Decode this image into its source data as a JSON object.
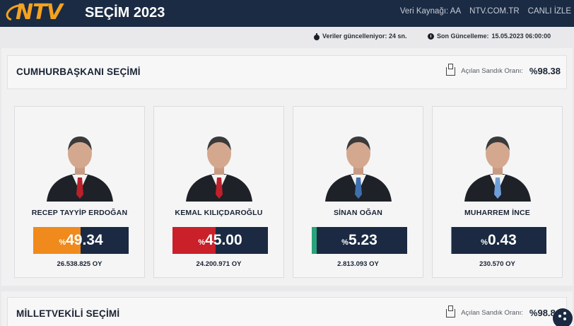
{
  "header": {
    "logo_text": "NTV",
    "app_title": "SEÇİM 2023",
    "links": [
      "Veri Kaynağı: AA",
      "NTV.COM.TR",
      "CANLI İZLE"
    ]
  },
  "status": {
    "refresh_text": "Veriler güncelleniyor: 24 sn.",
    "last_update_label": "Son Güncelleme:",
    "last_update_value": "15.05.2023 06:00:00"
  },
  "presidential": {
    "title": "CUMHURBAŞKANI SEÇİMİ",
    "rate_label": "Açılan Sandık Oranı:",
    "rate_value": "%98.38",
    "candidates": [
      {
        "name": "RECEP TAYYİP ERDOĞAN",
        "percent_sign": "%",
        "percent": "49.34",
        "share": 0.4934,
        "votes": "26.538.825 OY",
        "color": "#f08a1c",
        "tie_color": "#b8202a"
      },
      {
        "name": "KEMAL KILIÇDAROĞLU",
        "percent_sign": "%",
        "percent": "45.00",
        "share": 0.45,
        "votes": "24.200.971 OY",
        "color": "#c9202a",
        "tie_color": "#c0202a"
      },
      {
        "name": "SİNAN OĞAN",
        "percent_sign": "%",
        "percent": "5.23",
        "share": 0.0523,
        "votes": "2.813.093 OY",
        "color": "#2aa37a",
        "tie_color": "#3e6fae"
      },
      {
        "name": "MUHARREM İNCE",
        "percent_sign": "%",
        "percent": "0.43",
        "share": 0.0043,
        "votes": "230.570 OY",
        "color": "#3f9fd8",
        "tie_color": "#6f9fd8"
      }
    ]
  },
  "parliamentary": {
    "title": "MİLLETVEKİLİ SEÇİMİ",
    "rate_label": "Açılan Sandık Oranı:",
    "rate_value": "%98.84"
  },
  "icons": [
    "timer-icon",
    "clock-icon",
    "ballot-box-icon",
    "share-icon"
  ]
}
